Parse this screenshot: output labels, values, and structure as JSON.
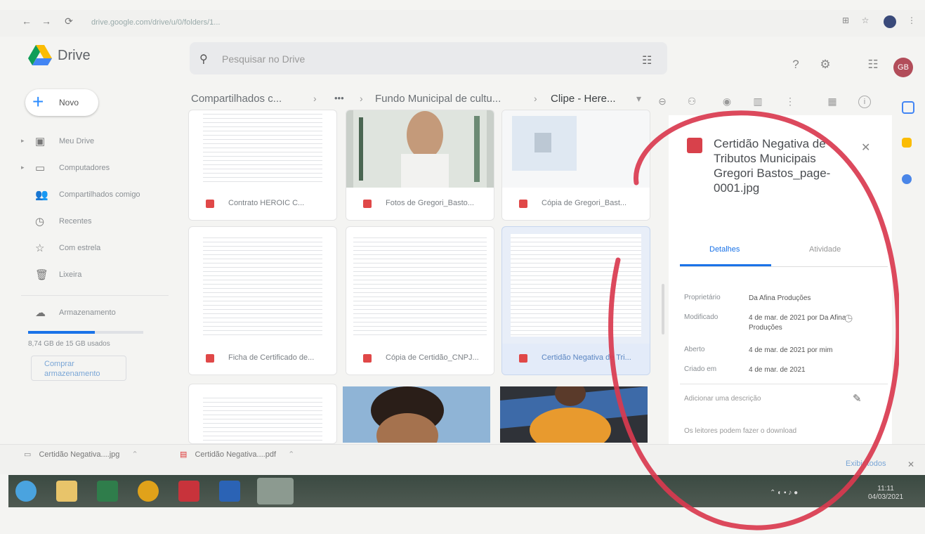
{
  "browser": {
    "url": "drive.google.com/drive/u/0/folders/1...",
    "nav": {
      "back": "←",
      "forward": "→",
      "reload": "⟳",
      "lock": "🔒"
    }
  },
  "header": {
    "app_title": "Drive",
    "search_placeholder": "Pesquisar no Drive",
    "avatar_initials": "GB"
  },
  "sidebar": {
    "new_label": "Novo",
    "items": [
      {
        "label": "Meu Drive",
        "icon": "drive-icon",
        "glyph": "▣",
        "caret": true
      },
      {
        "label": "Computadores",
        "icon": "computer-icon",
        "glyph": "▭",
        "caret": true
      },
      {
        "label": "Compartilhados comigo",
        "icon": "shared-icon",
        "glyph": "👥",
        "caret": false
      },
      {
        "label": "Recentes",
        "icon": "clock-icon",
        "glyph": "◷",
        "caret": false
      },
      {
        "label": "Com estrela",
        "icon": "star-icon",
        "glyph": "☆",
        "caret": false
      },
      {
        "label": "Lixeira",
        "icon": "trash-icon",
        "glyph": "🗑",
        "caret": false
      }
    ],
    "storage_label": "Armazenamento",
    "storage_used": "8,74 GB de 15 GB usados",
    "storage_fraction": 0.58,
    "buy_storage": "Comprar armazenamento"
  },
  "breadcrumb": {
    "items": [
      "Compartilhados c...",
      "Fundo Municipal de cultu...",
      "Clipe - Here..."
    ],
    "more": "•••"
  },
  "files": [
    {
      "name": "Contrato HEROIC C...",
      "kind": "doc"
    },
    {
      "name": "Fotos de Gregori_Basto...",
      "kind": "photo"
    },
    {
      "name": "Cópia de Gregori_Bast...",
      "kind": "card"
    },
    {
      "name": "Ficha de Certificado de...",
      "kind": "doc"
    },
    {
      "name": "Cópia de Certidão_CNPJ...",
      "kind": "doc"
    },
    {
      "name": "Certidão Negativa de Tri...",
      "kind": "doc"
    }
  ],
  "details": {
    "title": "Certidão Negativa de Tributos Municipais Gregori Bastos_page-0001.jpg",
    "tab_details": "Detalhes",
    "tab_activity": "Atividade",
    "rows": [
      {
        "label": "Proprietário",
        "value": "Da Afina Produções"
      },
      {
        "label": "Modificado",
        "value": "4 de mar. de 2021 por Da Afina Produções"
      },
      {
        "label": "Aberto",
        "value": "4 de mar. de 2021 por mim"
      },
      {
        "label": "Criado em",
        "value": "4 de mar. de 2021"
      }
    ],
    "add_description": "Adicionar uma descrição",
    "download_note": "Os leitores podem fazer o download"
  },
  "downloads": [
    {
      "name": "Certidão Negativa....jpg",
      "icon": "image-file-icon"
    },
    {
      "name": "Certidão Negativa....pdf",
      "icon": "pdf-file-icon"
    }
  ],
  "downloads_show_all": "Exibir todos",
  "taskbar": {
    "time": "11:11",
    "date": "04/03/2021"
  },
  "colors": {
    "accent": "#1a73e8",
    "annotation_circle": "#d9394f",
    "file_red": "#e04848"
  }
}
